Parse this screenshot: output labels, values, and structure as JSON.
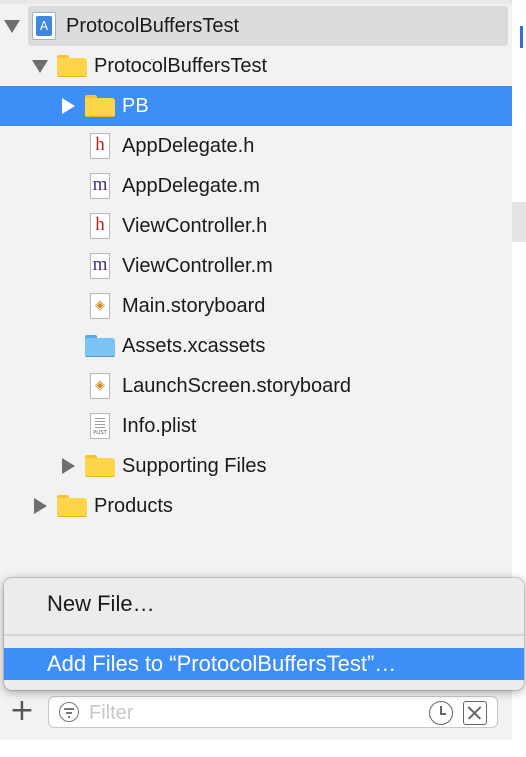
{
  "tree": {
    "items": [
      {
        "label": "ProtocolBuffersTest"
      },
      {
        "label": "ProtocolBuffersTest"
      },
      {
        "label": "PB"
      },
      {
        "label": "AppDelegate.h"
      },
      {
        "label": "AppDelegate.m"
      },
      {
        "label": "ViewController.h"
      },
      {
        "label": "ViewController.m"
      },
      {
        "label": "Main.storyboard"
      },
      {
        "label": "Assets.xcassets"
      },
      {
        "label": "LaunchScreen.storyboard"
      },
      {
        "label": "Info.plist"
      },
      {
        "label": "Supporting Files"
      },
      {
        "label": "Products"
      }
    ],
    "icons": {
      "h": "h",
      "m": "m",
      "plist_tag": "PLIST"
    }
  },
  "menu": {
    "items": [
      {
        "label": "New File…"
      },
      {
        "label": "Add Files to “ProtocolBuffersTest”…"
      }
    ]
  },
  "filter": {
    "placeholder": "Filter",
    "add_glyph": "+"
  },
  "colors": {
    "selection": "#3d8ef7",
    "folder": "#fcd54a",
    "header_file": "#b3241d",
    "impl_file": "#4a2c7d"
  }
}
